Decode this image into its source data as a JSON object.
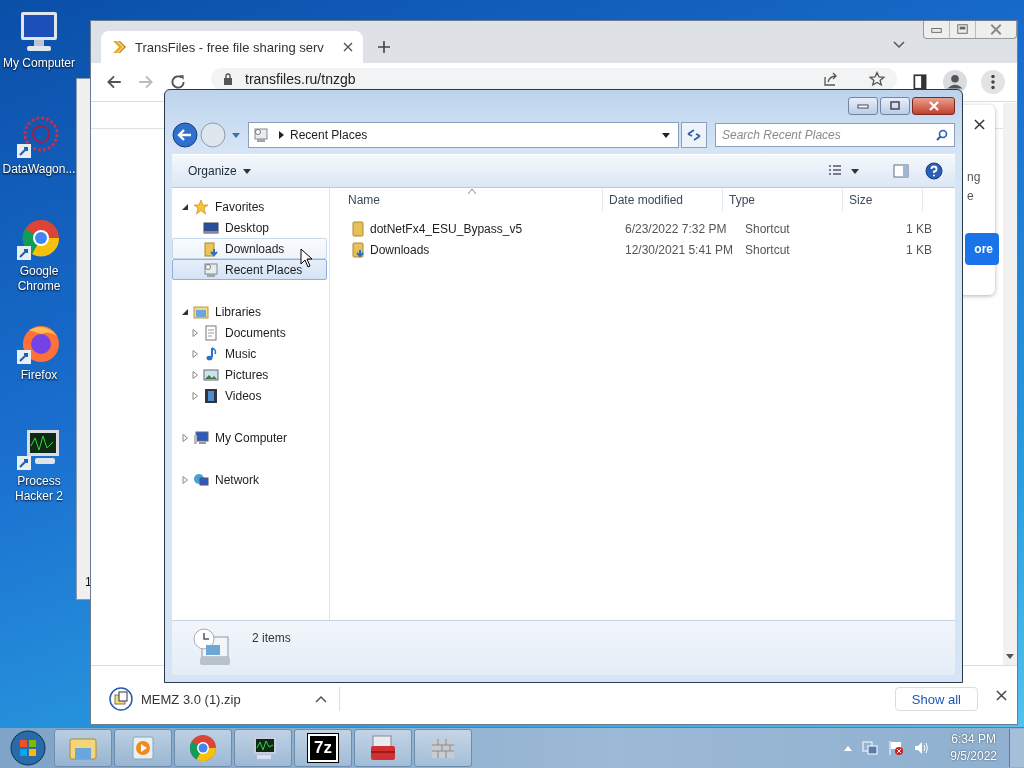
{
  "desktop_icons": [
    {
      "kind": "computer",
      "label": "My Computer"
    },
    {
      "kind": "molecule",
      "label": "DataWagon..."
    },
    {
      "kind": "chrome",
      "label": "Google Chrome"
    },
    {
      "kind": "firefox",
      "label": "Firefox"
    },
    {
      "kind": "monitor",
      "label": "Process Hacker 2"
    }
  ],
  "background_window": {
    "text": "1"
  },
  "browser": {
    "tab": {
      "title": "TransFiles - free file sharing serv",
      "selected": true
    },
    "url": "transfiles.ru/tnzgb",
    "page_fragments": [
      "ng",
      "e"
    ],
    "page_button": "ore",
    "download": {
      "filename": "MEMZ 3.0 (1).zip"
    },
    "show_all": "Show all"
  },
  "explorer": {
    "breadcrumb": "Recent Places",
    "search": {
      "placeholder": "Search Recent Places"
    },
    "organize": "Organize",
    "nav": [
      {
        "kind": "favorites",
        "label": "Favorites",
        "expanded": true,
        "children": [
          {
            "kind": "desktop",
            "label": "Desktop",
            "selected": false,
            "hovered": false
          },
          {
            "kind": "downloads",
            "label": "Downloads",
            "selected": false,
            "hovered": true
          },
          {
            "kind": "recent",
            "label": "Recent Places",
            "selected": true,
            "hovered": false
          }
        ]
      },
      {
        "kind": "library",
        "label": "Libraries",
        "expanded": true,
        "children": [
          {
            "kind": "documents",
            "label": "Documents",
            "expanded": false,
            "selected": false,
            "hovered": false
          },
          {
            "kind": "music",
            "label": "Music",
            "expanded": false,
            "selected": false,
            "hovered": false
          },
          {
            "kind": "pictures",
            "label": "Pictures",
            "expanded": false,
            "selected": false,
            "hovered": false
          },
          {
            "kind": "videos",
            "label": "Videos",
            "expanded": false,
            "selected": false,
            "hovered": false
          }
        ]
      },
      {
        "kind": "computer",
        "label": "My Computer",
        "expanded": false
      },
      {
        "kind": "network",
        "label": "Network",
        "expanded": false
      }
    ],
    "columns": [
      "Name",
      "Date modified",
      "Type",
      "Size"
    ],
    "rows": [
      {
        "kind": "folder",
        "name": "dotNetFx4_ESU_Bypass_v5",
        "date": "6/23/2022 7:32 PM",
        "type": "Shortcut",
        "size": "1 KB"
      },
      {
        "kind": "downloads",
        "name": "Downloads",
        "date": "12/30/2021 5:41 PM",
        "type": "Shortcut",
        "size": "1 KB"
      }
    ],
    "status": "2 items"
  },
  "taskbar": {
    "apps": [
      {
        "kind": "explorer"
      },
      {
        "kind": "media"
      },
      {
        "kind": "chrome"
      },
      {
        "kind": "monitor"
      },
      {
        "kind": "sevenzip",
        "label": "7z"
      },
      {
        "kind": "toolbox"
      },
      {
        "kind": "wall"
      }
    ],
    "time": "6:34 PM",
    "date": "9/5/2022"
  }
}
